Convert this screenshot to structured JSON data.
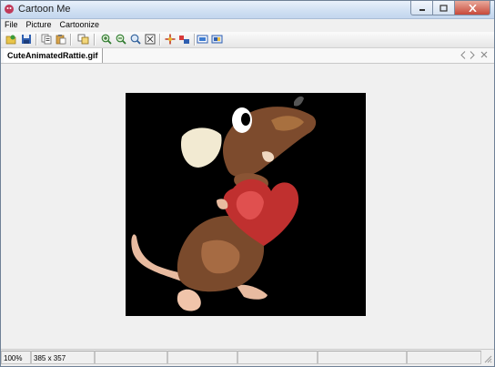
{
  "window": {
    "title": "Cartoon Me"
  },
  "menu": {
    "items": [
      "File",
      "Picture",
      "Cartoonize"
    ]
  },
  "toolbar": {
    "buttons": [
      "open-icon",
      "save-icon",
      "copy-icon",
      "paste-icon",
      "duplicate-icon",
      "zoom-in-icon",
      "zoom-out-icon",
      "zoom-actual-icon",
      "fit-window-icon",
      "move-icon",
      "resize-icon",
      "cartoon-preview-icon",
      "cartoonize-icon"
    ]
  },
  "tab": {
    "label": "CuteAnimatedRattie.gif"
  },
  "status": {
    "zoom": "100%",
    "dimensions": "385 x 357"
  },
  "colors": {
    "title_bar": "#cfdff2",
    "accent_close": "#c7493a",
    "canvas": "#f0f0f0",
    "image_bg": "#000000"
  }
}
